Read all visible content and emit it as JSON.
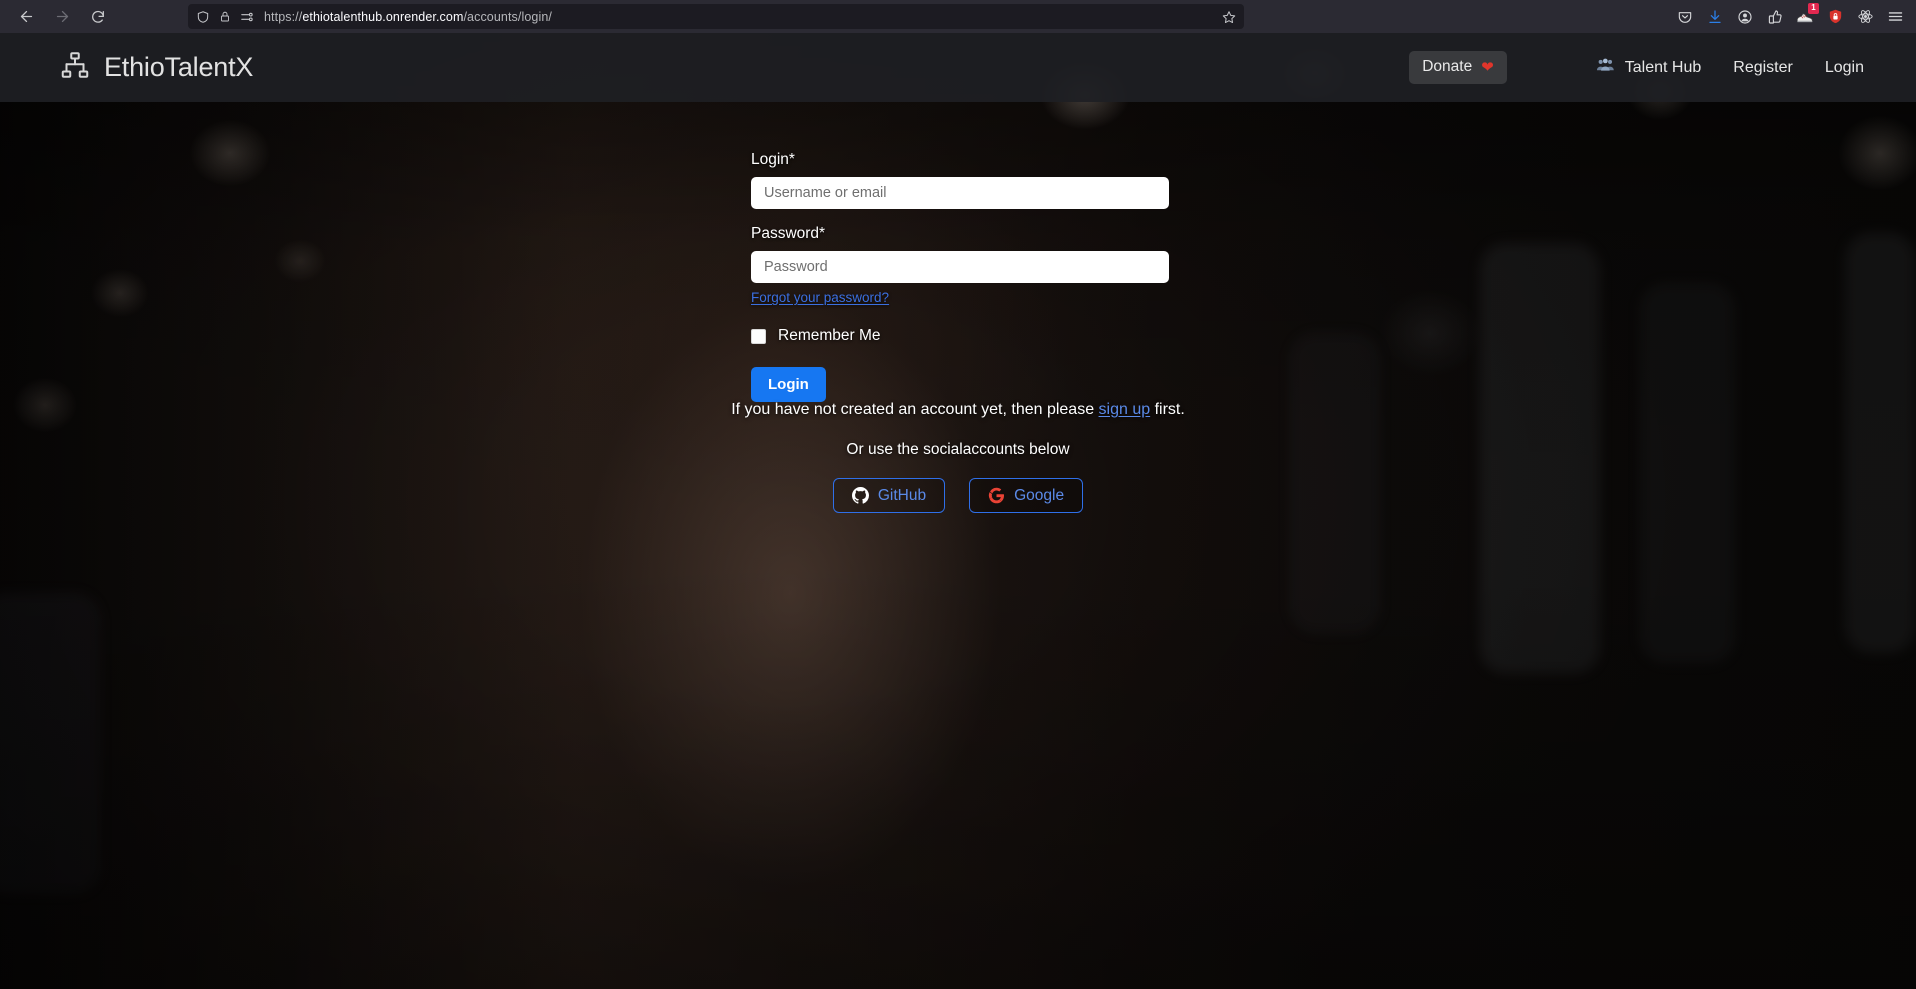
{
  "browser": {
    "back_icon": "back-arrow-icon",
    "forward_icon": "forward-arrow-icon",
    "reload_icon": "reload-icon",
    "url_protocol": "https://",
    "url_domain": "ethiotalenthub.onrender.com",
    "url_path": "/accounts/login/",
    "url_full": "https://ethiotalenthub.onrender.com/accounts/login/",
    "shield_icon": "shield-icon",
    "lock_icon": "padlock-icon",
    "permissions_icon": "page-settings-icon",
    "bookmark_icon": "star-icon",
    "toolbar_icons": [
      {
        "name": "pocket-icon",
        "badge": null
      },
      {
        "name": "downloads-icon",
        "badge": null
      },
      {
        "name": "account-icon",
        "badge": null
      },
      {
        "name": "thumbs-up-extension-icon",
        "badge": null
      },
      {
        "name": "sneaker-extension-icon",
        "badge": "1"
      },
      {
        "name": "shield-extension-icon",
        "badge": null
      },
      {
        "name": "react-devtools-icon",
        "badge": null
      },
      {
        "name": "app-menu-icon",
        "badge": null
      }
    ]
  },
  "header": {
    "logo_icon": "sitemap-icon",
    "brand": "EthioTalentX",
    "donate_label": "Donate",
    "donate_icon": "heart-icon",
    "nav": [
      {
        "label": "Talent Hub",
        "icon": "users-group-icon"
      },
      {
        "label": "Register",
        "icon": null
      },
      {
        "label": "Login",
        "icon": null
      }
    ]
  },
  "form": {
    "login_label": "Login*",
    "login_placeholder": "Username or email",
    "login_value": "",
    "password_label": "Password*",
    "password_placeholder": "Password",
    "password_value": "",
    "forgot_link": "Forgot your password?",
    "remember_label": "Remember Me",
    "remember_checked": false,
    "submit_label": "Login"
  },
  "footer_text": {
    "signup_prefix": "If you have not created an account yet, then please ",
    "signup_link": "sign up",
    "signup_suffix": " first.",
    "social_heading": "Or use the socialaccounts below"
  },
  "social": [
    {
      "label": "GitHub",
      "icon": "github-icon",
      "icon_color": "#ffffff"
    },
    {
      "label": "Google",
      "icon": "google-g-icon",
      "icon_color": "#ea4335"
    }
  ],
  "colors": {
    "accent_blue": "#1677f2",
    "link_blue": "#3b6fe0",
    "social_border": "#2f6fe8",
    "heart_red": "#e0352b",
    "header_bg": "#1e1f24",
    "chrome_bg": "#2b2a33"
  }
}
